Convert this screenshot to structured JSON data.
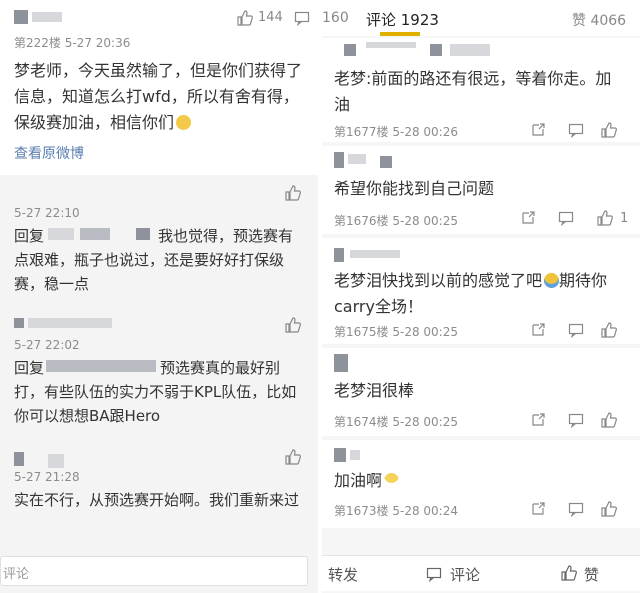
{
  "left": {
    "top_comment": {
      "meta": "第222楼 5-27 20:36",
      "likes": "144",
      "body": "梦老师，今天虽然输了，但是你们获得了信息，知道怎么打wfd，所以有舍有得，保级赛加油，相信你们",
      "view_original": "查看原微博"
    },
    "replies": [
      {
        "time": "5-27 22:10",
        "body_prefix": "回复",
        "body": "我也觉得，预选赛有点艰难，瓶子也说过，还是要好好打保级赛，稳一点"
      },
      {
        "time": "5-27 22:02",
        "body_prefix": "回复",
        "body_mid": "预选赛真的最好别",
        "body": "打，有些队伍的实力不弱于KPL队伍，比如你可以想想BA跟Hero"
      },
      {
        "time": "5-27 21:28",
        "body": "实在不行，从预选赛开始啊。我们重新来过"
      }
    ],
    "reply_placeholder": "评论",
    "header_right_count": "160"
  },
  "right": {
    "tabs": {
      "comments_label": "评论 1923",
      "likes_label": "赞 4066"
    },
    "comments": [
      {
        "body": "老梦:前面的路还有很远，等着你走。加油",
        "meta": "第1677楼 5-28 00:26",
        "likes": ""
      },
      {
        "body": "希望你能找到自己问题",
        "meta": "第1676楼 5-28 00:25",
        "likes": "1"
      },
      {
        "body": "老梦泪快找到以前的感觉了吧",
        "body_tail": "期待你carry全场！",
        "meta": "第1675楼 5-28 00:25",
        "likes": ""
      },
      {
        "body": "老梦泪很棒",
        "meta": "第1674楼 5-28 00:25",
        "likes": ""
      },
      {
        "body": "加油啊",
        "meta": "第1673楼 5-28 00:24",
        "likes": ""
      }
    ],
    "bottom": {
      "repost": "转发",
      "comment": "评论",
      "like": "赞"
    }
  },
  "colors": {
    "link": "#5a7fb0",
    "meta": "#8c8c8c",
    "text": "#333333",
    "blur": "#b9bcc3"
  },
  "icons": [
    "thumbs-up-icon",
    "comment-icon",
    "share-icon",
    "more-icon"
  ]
}
